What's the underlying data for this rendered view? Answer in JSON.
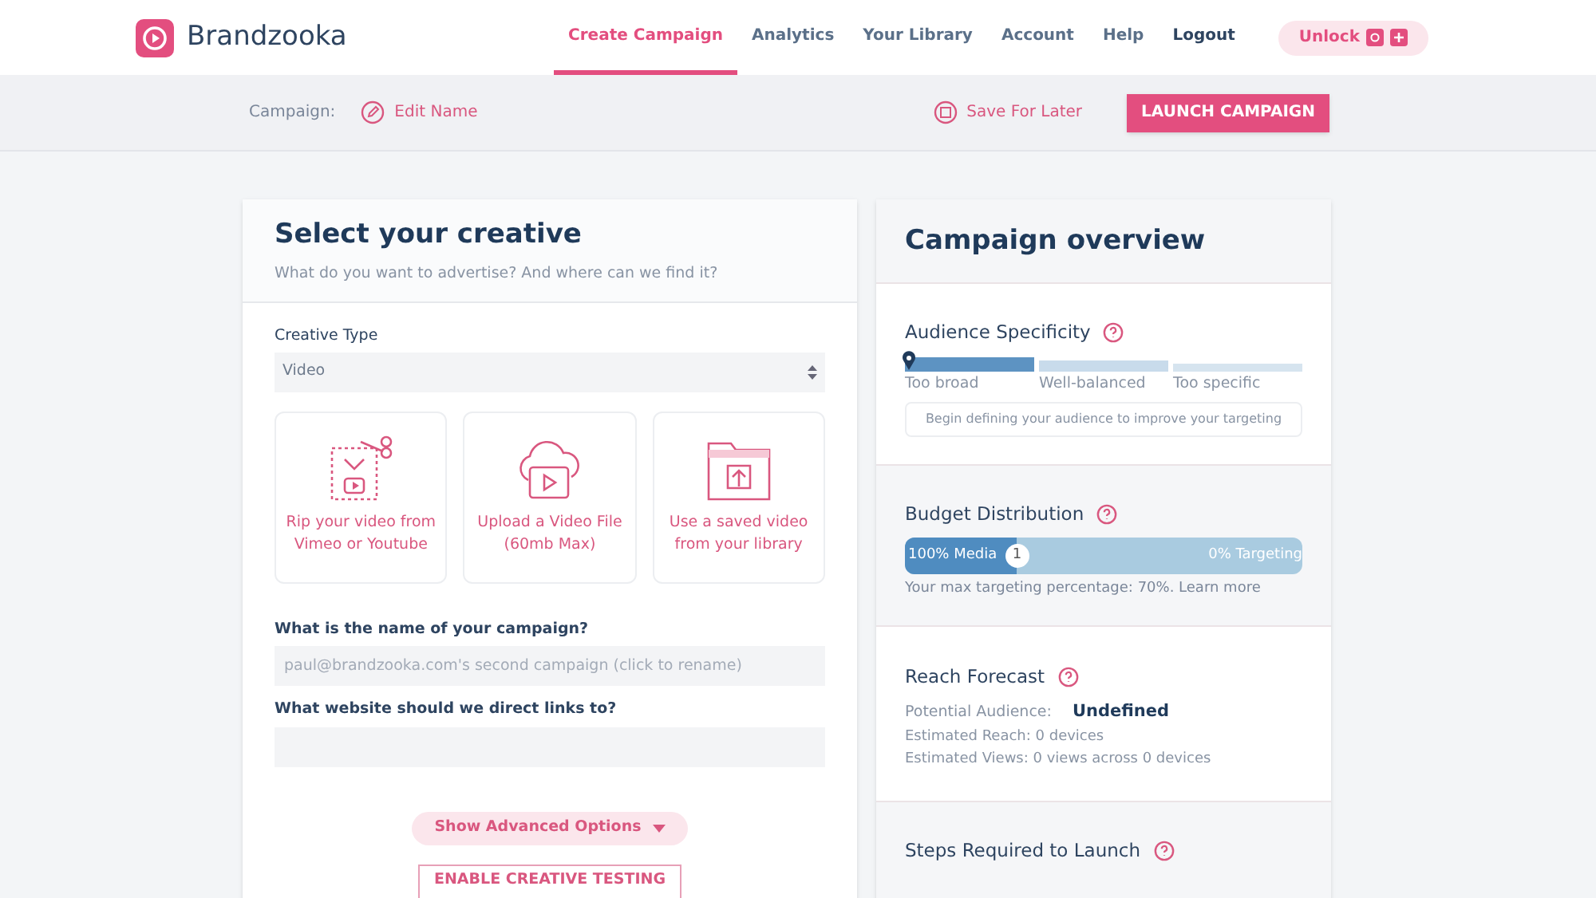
{
  "brand": "Brandzooka",
  "nav": [
    {
      "label": "Create Campaign",
      "selected": true
    },
    {
      "label": "Analytics",
      "selected": false
    },
    {
      "label": "Your Library",
      "selected": false
    },
    {
      "label": "Account",
      "selected": false
    },
    {
      "label": "Help",
      "selected": false
    },
    {
      "label": "Logout",
      "selected": false
    }
  ],
  "unlock": "Unlock",
  "campaign_bar": {
    "label": "Campaign:",
    "edit": "Edit Name",
    "save": "Save For Later",
    "launch": "LAUNCH CAMPAIGN"
  },
  "creative": {
    "title": "Select your creative",
    "subtitle": "What do you want to advertise? And where can we find it?",
    "type_label": "Creative Type",
    "type_value": "Video",
    "options": [
      {
        "kind": "rip",
        "lines": [
          "Rip your video from",
          "Vimeo or Youtube"
        ]
      },
      {
        "kind": "upload",
        "lines": [
          "Upload a Video File",
          "(60mb Max)"
        ]
      },
      {
        "kind": "library",
        "lines": [
          "Use a saved video",
          "from your library"
        ]
      }
    ],
    "name_label": "What is the name of your campaign?",
    "name_placeholder": "paul@brandzooka.com's second campaign (click to rename)",
    "website_label": "What website should we direct links to?",
    "advanced": "Show Advanced Options",
    "testing": "ENABLE CREATIVE TESTING"
  },
  "overview": {
    "title": "Campaign overview",
    "audience": {
      "title": "Audience Specificity",
      "segments": [
        {
          "label": "Too broad",
          "selected": true
        },
        {
          "label": "Well-balanced",
          "selected": false
        },
        {
          "label": "Too specific",
          "selected": false
        }
      ],
      "hint": "Begin defining your audience to improve your targeting"
    },
    "budget": {
      "title": "Budget Distribution",
      "level": 0.28,
      "left": "100% Media",
      "thumb": "1",
      "right": "0% Targeting",
      "note": "Your max targeting percentage: 70%. Learn more"
    },
    "reach": {
      "title": "Reach Forecast",
      "potential_label": "Potential Audience:",
      "potential_value": "Undefined",
      "lines": [
        "Estimated Reach: 0 devices",
        "Estimated Views: 0 views across 0 devices"
      ]
    },
    "steps": {
      "title": "Steps Required to Launch"
    }
  }
}
